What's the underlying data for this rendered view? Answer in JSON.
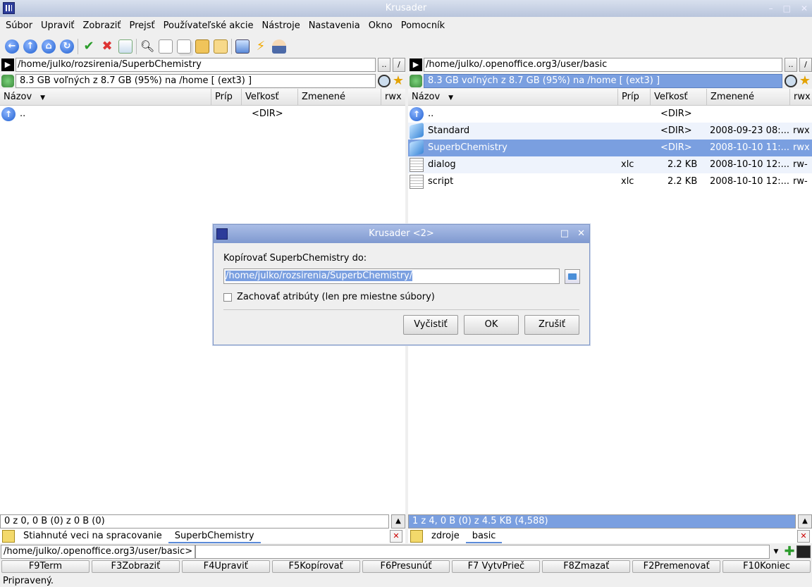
{
  "window": {
    "title": "Krusader",
    "controls": [
      "–",
      "□",
      "✕"
    ]
  },
  "menu": [
    "Súbor",
    "Upraviť",
    "Zobraziť",
    "Prejsť",
    "Používateľské akcie",
    "Nástroje",
    "Nastavenia",
    "Okno",
    "Pomocník"
  ],
  "toolbar_icons": [
    "back-icon",
    "up-icon",
    "home-icon",
    "refresh-icon",
    "select-icon",
    "delete-icon",
    "trash-icon",
    "search-icon",
    "new-file-icon",
    "copy-icon",
    "move-icon",
    "pack-icon",
    "network-icon",
    "lightning-icon",
    "user-icon"
  ],
  "left_panel": {
    "path": "/home/julko/rozsirenia/SuperbChemistry",
    "free_space": "8.3 GB voľných z 8.7 GB (95%) na /home [ (ext3) ]",
    "columns": [
      "Názov",
      "Príp",
      "Veľkosť",
      "Zmenené",
      "rwx"
    ],
    "rows": [
      {
        "name": "..",
        "ext": "",
        "size": "<DIR>",
        "modified": "",
        "perm": ""
      }
    ],
    "status": "0 z 0, 0 B (0) z 0 B (0)",
    "tabs": [
      "Stiahnuté veci na spracovanie",
      "SuperbChemistry"
    ]
  },
  "right_panel": {
    "path": "/home/julko/.openoffice.org3/user/basic",
    "free_space": "8.3 GB voľných z 8.7 GB (95%) na /home [ (ext3) ]",
    "columns": [
      "Názov",
      "Príp",
      "Veľkosť",
      "Zmenené",
      "rwx"
    ],
    "rows": [
      {
        "name": "..",
        "ext": "",
        "size": "<DIR>",
        "modified": "",
        "perm": ""
      },
      {
        "name": "Standard",
        "ext": "",
        "size": "<DIR>",
        "modified": "2008-09-23 08:...",
        "perm": "rwx"
      },
      {
        "name": "SuperbChemistry",
        "ext": "",
        "size": "<DIR>",
        "modified": "2008-10-10 11:...",
        "perm": "rwx"
      },
      {
        "name": "dialog",
        "ext": "xlc",
        "size": "2.2 KB",
        "modified": "2008-10-10 12:...",
        "perm": "rw-"
      },
      {
        "name": "script",
        "ext": "xlc",
        "size": "2.2 KB",
        "modified": "2008-10-10 12:...",
        "perm": "rw-"
      }
    ],
    "status": "1 z 4, 0 B (0) z 4.5 KB (4,588)",
    "tabs": [
      "zdroje",
      "basic"
    ]
  },
  "path_buttons": {
    "parent": "..",
    "root": "/"
  },
  "command_line": {
    "label": "/home/julko/.openoffice.org3/user/basic>",
    "value": ""
  },
  "function_keys": [
    "F9Term",
    "F3Zobraziť",
    "F4Upraviť",
    "F5Kopírovať",
    "F6Presunúť",
    "F7 VytvPrieč",
    "F8Zmazať",
    "F2Premenovať",
    "F10Koniec"
  ],
  "app_status": "Pripravený.",
  "dialog": {
    "title": "Krusader <2>",
    "label": "Kopírovať SuperbChemistry do:",
    "destination": "/home/julko/rozsirenia/SuperbChemistry/",
    "checkbox_label": "Zachovať atribúty (len pre miestne súbory)",
    "checkbox_checked": false,
    "buttons": [
      "Vyčistiť",
      "OK",
      "Zrušiť"
    ]
  },
  "colors": {
    "selection": "#7a9fe0",
    "titlebar": "#b9c5dc",
    "alt_row": "#eef3fc"
  }
}
